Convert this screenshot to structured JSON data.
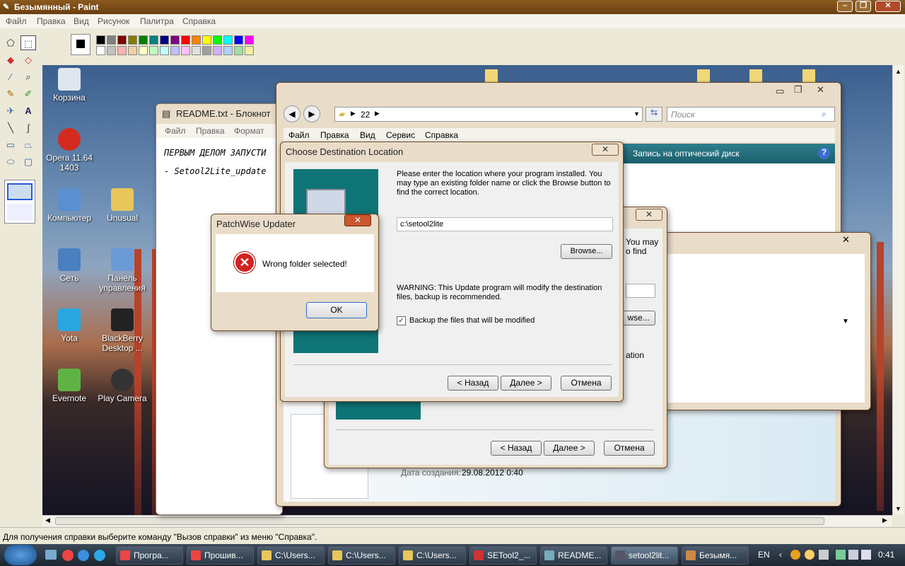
{
  "paint": {
    "title": "Безымянный - Paint",
    "menu": [
      "Файл",
      "Правка",
      "Вид",
      "Рисунок",
      "Палитра",
      "Справка"
    ],
    "status": "Для получения справки выберите команду \"Вызов справки\" из меню \"Справка\".",
    "palette_top": [
      "#000000",
      "#808080",
      "#800000",
      "#808000",
      "#008000",
      "#008080",
      "#000080",
      "#800080",
      "#ff0000",
      "#ff8000",
      "#ffff00",
      "#00ff00",
      "#00ffff",
      "#0000ff",
      "#ff00ff"
    ],
    "palette_bottom": [
      "#ffffff",
      "#c0c0c0",
      "#ffb0b0",
      "#f0d0a0",
      "#ffffc0",
      "#c0ffc0",
      "#c0ffff",
      "#c0c0ff",
      "#ffc0ff",
      "#e0e0e0",
      "#a0a0a0",
      "#d0b0ff",
      "#b0d0ff",
      "#a0e0a0",
      "#f0f0a0"
    ]
  },
  "desktop": {
    "icons": [
      {
        "label": "Корзина"
      },
      {
        "label": "Opera 11.64 1403"
      },
      {
        "label": "Компьютер"
      },
      {
        "label": "Unusual"
      },
      {
        "label": "Сеть"
      },
      {
        "label": "Панель управления"
      },
      {
        "label": "Yota"
      },
      {
        "label": "BlackBerry Desktop ..."
      },
      {
        "label": "Evernote"
      },
      {
        "label": "Play Camera"
      }
    ]
  },
  "notepad": {
    "title": "README.txt - Блокнот",
    "menu": [
      "Файл",
      "Правка",
      "Формат"
    ],
    "line1": "ПЕРВЫМ ДЕЛОМ ЗАПУСТИ",
    "line2": "- Setool2Lite_update"
  },
  "explorer": {
    "path_item": "22",
    "search_placeholder": "Поиск",
    "menu": [
      "Файл",
      "Правка",
      "Вид",
      "Сервис",
      "Справка"
    ],
    "burn_label": "Запись на оптический диск",
    "date_label": "Дата создания:",
    "date_value": "29.08.2012 0:40"
  },
  "back_installer": {
    "frag1": "You may",
    "frag2": "o find",
    "browse": "wse...",
    "frag3": "ation",
    "back": "< Назад",
    "next": "Далее >",
    "cancel": "Отмена"
  },
  "choose": {
    "title": "Choose Destination Location",
    "desc": "Please enter the location where your program installed.  You may type an existing folder name or click the Browse button to find the correct location.",
    "path": "c:\\setool2lite",
    "browse": "Browse...",
    "warning": "WARNING:  This Update program will modify the destination files, backup is recommended.",
    "backup_label": "Backup the files that will be modified",
    "back": "< Назад",
    "next": "Далее >",
    "cancel": "Отмена"
  },
  "alert": {
    "title": "PatchWise Updater",
    "message": "Wrong folder selected!",
    "ok": "OK"
  },
  "taskbar": {
    "items": [
      {
        "label": "Програ..."
      },
      {
        "label": "Прошив..."
      },
      {
        "label": "C:\\Users..."
      },
      {
        "label": "C:\\Users..."
      },
      {
        "label": "C:\\Users..."
      },
      {
        "label": "SETool2_..."
      },
      {
        "label": "README..."
      },
      {
        "label": "setool2lit..."
      },
      {
        "label": "Безымя..."
      }
    ],
    "lang": "EN",
    "clock": "0:41"
  }
}
